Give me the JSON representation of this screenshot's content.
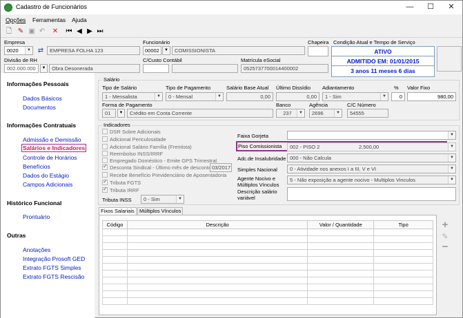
{
  "window": {
    "title": "Cadastro de Funcionários"
  },
  "menu": [
    "Opções",
    "Ferramentas",
    "Ajuda"
  ],
  "header": {
    "empresa_label": "Empresa",
    "empresa_code": "0020",
    "empresa_name": "EMPRESA FOLHA 123",
    "funcionario_label": "Funcionário",
    "funcionario_code": "00002",
    "funcionario_name": "COMISSIONISTA",
    "chapeira_label": "Chapeira",
    "chapeira_value": "",
    "cond_label": "Condição Atual e Tempo de Serviço",
    "status": "ATIVO",
    "admissao": "ADMITIDO EM: 01/01/2015",
    "tempo": "3 anos 11 meses 6 dias",
    "divisao_label": "Divisão de RH",
    "divisao_code": "002.000.000",
    "divisao_name": "Obra Desonerada",
    "ccusto_label": "C/Custo Contábil",
    "ccusto_value": "",
    "matricula_label": "Matrícula eSocial",
    "matricula_value": "0525737700014400002"
  },
  "sidebar": {
    "sections": [
      {
        "title": "Informações Pessoais",
        "items": [
          "Dados Básicos",
          "Documentos"
        ]
      },
      {
        "title": "Informações Contratuais",
        "items": [
          "Admissão e Demissão",
          "Salários e Indicadores",
          "Controle de Horários",
          "Benefícios",
          "Dados do Estágio",
          "Campos Adicionais"
        ]
      },
      {
        "title": "Histórico Funcional",
        "items": [
          "Prontuário"
        ]
      },
      {
        "title": "Outras",
        "items": [
          "Anotações",
          "Integração Prosoft GED",
          "Extrato FGTS Simples",
          "Extrato FGTS Rescisão"
        ]
      }
    ]
  },
  "salario": {
    "group_label": "Salário",
    "tipo_label": "Tipo de Salário",
    "tipo_value": "1 - Mensalista",
    "pagamento_label": "Tipo de Pagamento",
    "pagamento_value": "0 - Mensal",
    "base_label": "Salário Base Atual",
    "base_value": "0,00",
    "ultimo_label": "Último Dissídio",
    "ultimo_value": "0,00",
    "adiant_label": "Adiantamento",
    "adiant_value": "1 - Sim",
    "pct_label": "%",
    "pct_value": "0",
    "fixo_label": "Valor Fixo",
    "fixo_value": "980,00",
    "forma_label": "Forma de Pagamento",
    "forma_code": "01",
    "forma_name": "Crédito em Conta Corrente",
    "banco_label": "Banco",
    "banco_value": "237",
    "agencia_label": "Agência",
    "agencia_value": "2696",
    "cc_label": "C/C Número",
    "cc_value": "54555"
  },
  "indicadores": {
    "group_label": "Indicadores",
    "checks": [
      {
        "label": "DSR Sobre Adicionais",
        "checked": false
      },
      {
        "label": "Adicional Periculosidade",
        "checked": false
      },
      {
        "label": "Adicional Salário Família (Frentista)",
        "checked": false
      },
      {
        "label": "Reembolso INSS/IRRF",
        "checked": false
      },
      {
        "label": "Empregado Doméstico - Emite GPS Trimestral",
        "checked": false
      },
      {
        "label": "Desconta Sindical - Último mês de desconto",
        "checked": true
      },
      {
        "label": "Recebe Benefício Previdenciário de Aposentadoria",
        "checked": false
      },
      {
        "label": "Tributa FGTS",
        "checked": true
      },
      {
        "label": "Tributa IRRF",
        "checked": true
      }
    ],
    "sindical_mes": "03/2017",
    "tributa_inss_label": "Tributa INSS",
    "tributa_inss_value": "0 - Sim",
    "gorjeta_label": "Faixa Gorjeta",
    "gorjeta_value": "",
    "piso_label": "Piso Comissionista",
    "piso_name": "002 - PISO 2",
    "piso_value": "2.500,00",
    "insalub_label": "Adc.de Insalubridade",
    "insalub_value": "000 - Não Calcula",
    "simples_label": "Simples Nacional",
    "simples_value": "0 - Atividade nos anexos I a III, V e VI",
    "agente_label": "Agente Nocivo e Múltiplos Vínculos",
    "agente_value": "5 - Não exposição a agente nocivo - Multiplos Vinculos",
    "desc_label": "Descrição salário variável",
    "desc_value": ""
  },
  "tabs": [
    "Fixos Salariais",
    "Múltiplos Vínculos"
  ],
  "grid": {
    "columns": [
      "Código",
      "Descrição",
      "Valor / Quantidade",
      "Tipo"
    ]
  }
}
